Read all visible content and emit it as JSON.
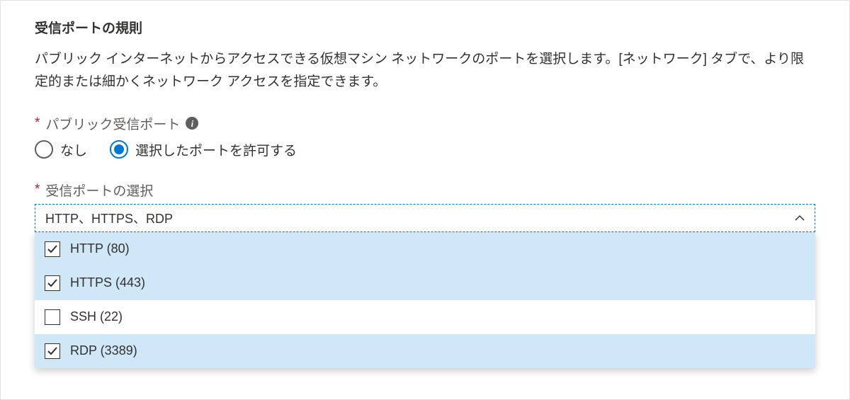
{
  "section": {
    "heading": "受信ポートの規則",
    "description": "パブリック インターネットからアクセスできる仮想マシン ネットワークのポートを選択します。[ネットワーク] タブで、より限定的または細かくネットワーク アクセスを指定できます。"
  },
  "fields": {
    "publicInboundPorts": {
      "label": "パブリック受信ポート",
      "required": "*",
      "options": [
        {
          "label": "なし",
          "selected": false
        },
        {
          "label": "選択したポートを許可する",
          "selected": true
        }
      ]
    },
    "selectInboundPorts": {
      "label": "受信ポートの選択",
      "required": "*",
      "value": "HTTP、HTTPS、RDP",
      "options": [
        {
          "label": "HTTP (80)",
          "checked": true
        },
        {
          "label": "HTTPS (443)",
          "checked": true
        },
        {
          "label": "SSH (22)",
          "checked": false
        },
        {
          "label": "RDP (3389)",
          "checked": true
        }
      ]
    }
  }
}
